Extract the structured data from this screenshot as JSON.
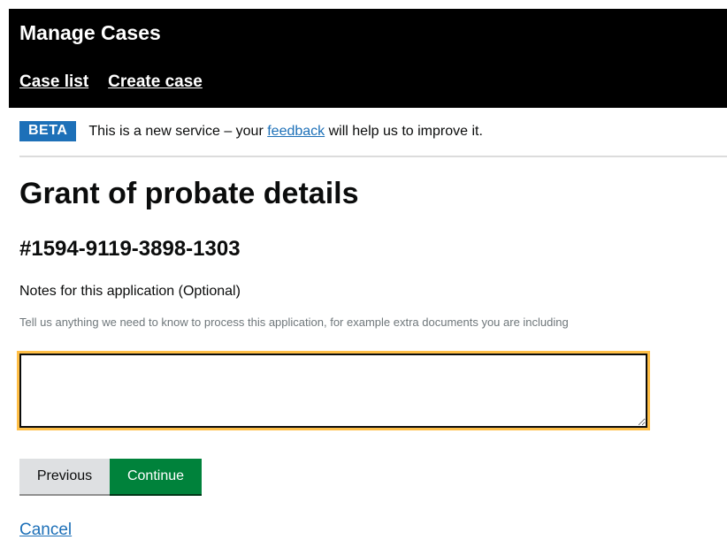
{
  "header": {
    "title": "Manage Cases",
    "nav": [
      "Case list",
      "Create case"
    ]
  },
  "beta_banner": {
    "tag": "BETA",
    "text_before": "This is a new service – your ",
    "link": "feedback",
    "text_after": " will help us to improve it."
  },
  "main": {
    "title": "Grant of probate details",
    "case_reference": "#1594-9119-3898-1303",
    "notes_label": "Notes for this application (Optional)",
    "notes_hint": "Tell us anything we need to know to process this application, for example extra documents you are including",
    "notes_value": ""
  },
  "actions": {
    "previous_label": "Previous",
    "continue_label": "Continue",
    "cancel_label": "Cancel"
  },
  "colors": {
    "header_bg": "#000000",
    "beta_tag": "#1d70b8",
    "continue_button": "#00823b",
    "focus_outline": "#ffbf47",
    "link": "#1d70b8"
  }
}
